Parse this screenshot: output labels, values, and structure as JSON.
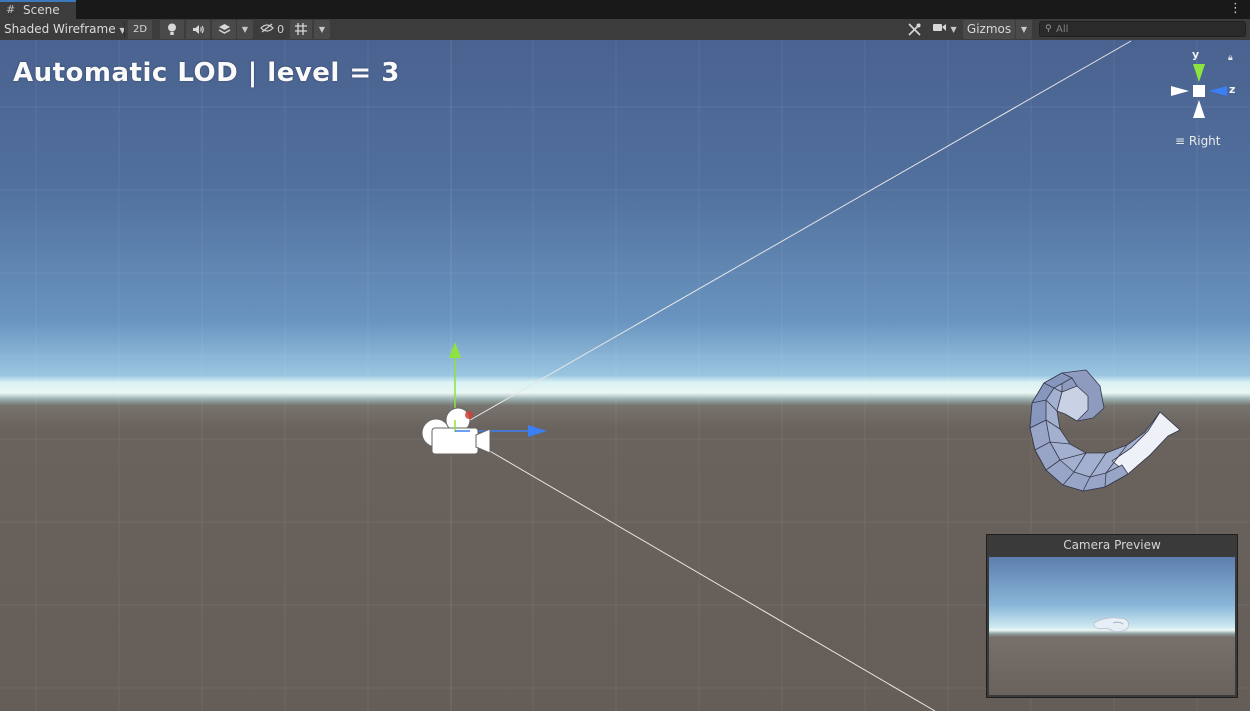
{
  "tab": {
    "label": "Scene"
  },
  "toolbar": {
    "shading_mode": "Shaded Wireframe",
    "mode_2d": "2D",
    "hidden_count": "0",
    "gizmos_label": "Gizmos",
    "search_placeholder": "All"
  },
  "viewport": {
    "overlay_text": "Automatic LOD | level = 3",
    "orientation": {
      "view_label": "Right",
      "axis_y": "y",
      "axis_z": "z"
    }
  },
  "camera_preview": {
    "title": "Camera Preview"
  },
  "colors": {
    "axis_y": "#8ee43e",
    "axis_z": "#3b7ff4",
    "axis_x": "#d0413a",
    "tab_accent": "#3a79bb"
  },
  "icons": [
    "grid-icon",
    "kebab-icon",
    "light-icon",
    "audio-icon",
    "effects-icon",
    "hidden-eye-icon",
    "grid-snap-icon",
    "tools-icon",
    "camera-icon",
    "search-icon",
    "lock-icon",
    "hamburger-icon",
    "camera-gizmo-icon"
  ]
}
